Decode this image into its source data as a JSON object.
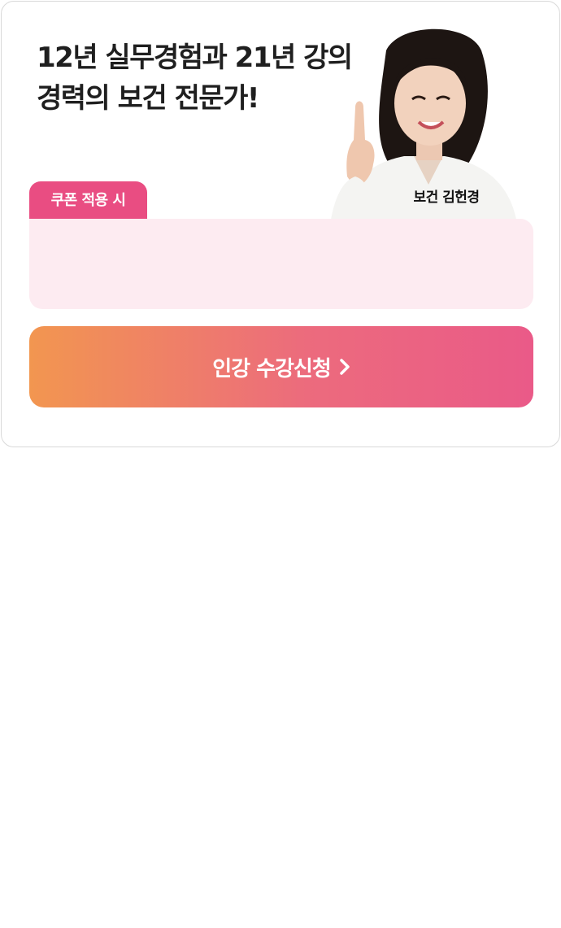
{
  "headline": {
    "line1": "12년 실무경험과 21년 강의",
    "line2": "경력의 보건 전문가!"
  },
  "instructor": {
    "name": "보건 김헌경"
  },
  "coupon": {
    "tab_label": "쿠폰 적용 시",
    "box_text": ""
  },
  "cta": {
    "label": "인강 수강신청",
    "icon": "chevron-right-icon"
  },
  "colors": {
    "accent_pink": "#e94d82",
    "coupon_bg": "#fdebf1",
    "cta_gradient_start": "#f29650",
    "cta_gradient_end": "#ea5a88"
  }
}
